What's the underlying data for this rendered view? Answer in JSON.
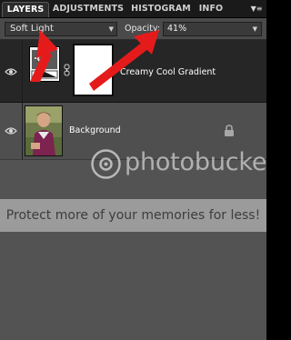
{
  "tabs": [
    {
      "label": "LAYERS"
    },
    {
      "label": "ADJUSTMENTS"
    },
    {
      "label": "HISTOGRAM"
    },
    {
      "label": "INFO"
    }
  ],
  "blend_mode": {
    "value": "Soft Light"
  },
  "opacity": {
    "label": "Opacity:",
    "value": "41%"
  },
  "layers": [
    {
      "name": "Creamy Cool Gradient",
      "visible": true,
      "type": "adjustment-with-mask"
    },
    {
      "name": "Background",
      "visible": true,
      "type": "photo",
      "locked": true
    }
  ],
  "watermark": {
    "brand": "photobucket",
    "band_text": "Protect more of your memories for less!"
  },
  "annotation_color": "#e51b1b",
  "icons": [
    "eye-icon",
    "link-icon",
    "lock-icon",
    "panel-menu-icon",
    "dropdown-arrow-icon"
  ]
}
